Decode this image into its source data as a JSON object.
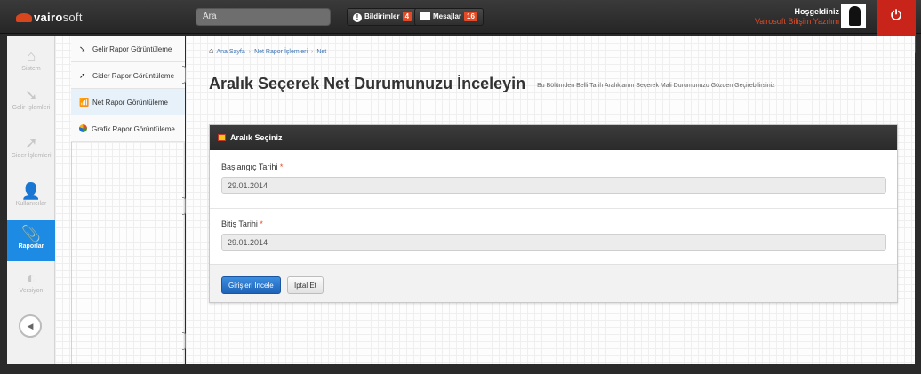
{
  "app": {
    "brand_main": "vairo",
    "brand_soft": "soft",
    "search_placeholder": "Ara",
    "notifications_label": "Bildirimler",
    "notifications_count": "4",
    "messages_label": "Mesajlar",
    "messages_count": "16",
    "greeting": "Hoşgeldiniz",
    "user_name": "Vairosoft Bilişim Yazılım"
  },
  "sidebar": {
    "items": [
      {
        "label": "Sistem",
        "icon": "home-icon"
      },
      {
        "label": "Gelir İşlemleri",
        "icon": "income-arrow-icon"
      },
      {
        "label": "Gider İşlemleri",
        "icon": "expense-arrow-icon"
      },
      {
        "label": "Kullanıcılar",
        "icon": "add-user-icon"
      },
      {
        "label": "Raporlar",
        "icon": "paperclip-icon",
        "active": true
      },
      {
        "label": "Versiyon",
        "icon": "toggle-icon"
      }
    ]
  },
  "submenu": {
    "items": [
      {
        "label": "Gelir Rapor Görüntüleme"
      },
      {
        "label": "Gider Rapor Görüntüleme"
      },
      {
        "label": "Net Rapor Görüntüleme",
        "active": true
      },
      {
        "label": "Grafik Rapor Görüntüleme"
      }
    ]
  },
  "breadcrumb": [
    "Ana Sayfa",
    "Net Rapor İşlemleri",
    "Net"
  ],
  "page": {
    "title": "Aralık Seçerek Net Durumunuzu İnceleyin",
    "subtitle": "Bu Bölümden Belli Tarih Aralıklarını Seçerek Mali Durumunuzu Gözden Geçirebilirsiniz"
  },
  "panel": {
    "title": "Aralık Seçiniz",
    "start_label": "Başlangıç Tarihi",
    "start_value": "29.01.2014",
    "end_label": "Bitiş Tarihi",
    "end_value": "29.01.2014",
    "required_mark": "*",
    "submit_label": "Girişleri İncele",
    "cancel_label": "İptal Et"
  },
  "colors": {
    "accent": "#1d8ae3",
    "danger": "#c9241a",
    "badge": "#e24b26"
  }
}
